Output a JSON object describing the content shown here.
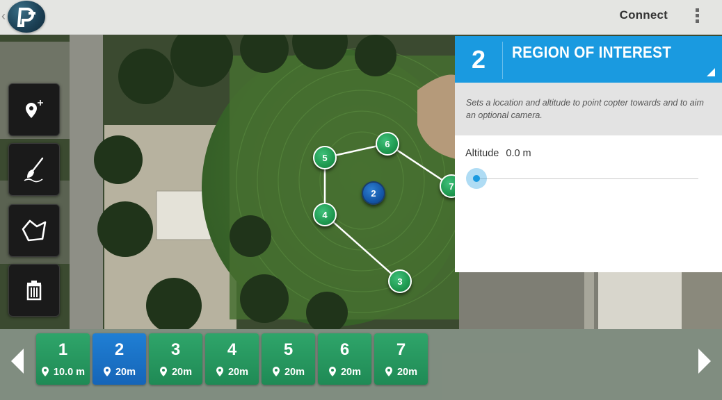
{
  "actionbar": {
    "connect_label": "Connect"
  },
  "icons": {
    "add_waypoint": "map-marker-plus-icon",
    "draw": "paintbrush-icon",
    "polygon": "polygon-icon",
    "trash": "trash-icon",
    "overflow": "more-vertical-icon",
    "logo": "droidplanner-logo"
  },
  "map": {
    "markers": [
      {
        "label": "5",
        "kind": "waypoint"
      },
      {
        "label": "6",
        "kind": "waypoint"
      },
      {
        "label": "7",
        "kind": "waypoint"
      },
      {
        "label": "2",
        "kind": "roi"
      },
      {
        "label": "4",
        "kind": "waypoint"
      },
      {
        "label": "3",
        "kind": "waypoint"
      }
    ]
  },
  "panel": {
    "number": "2",
    "title": "REGION OF INTEREST",
    "description": "Sets a location and altitude to point copter towards and to aim an optional camera.",
    "altitude_label": "Altitude",
    "altitude_value": "0.0 m",
    "altitude_slider_fraction": 0
  },
  "waypoints": [
    {
      "number": "1",
      "altitude": "10.0 m",
      "selected": false
    },
    {
      "number": "2",
      "altitude": "20m",
      "selected": true
    },
    {
      "number": "3",
      "altitude": "20m",
      "selected": false
    },
    {
      "number": "4",
      "altitude": "20m",
      "selected": false
    },
    {
      "number": "5",
      "altitude": "20m",
      "selected": false
    },
    {
      "number": "6",
      "altitude": "20m",
      "selected": false
    },
    {
      "number": "7",
      "altitude": "20m",
      "selected": false
    }
  ],
  "colors": {
    "accent_blue": "#1a9ae0",
    "waypoint_green": "#1f9950",
    "selected_blue": "#1665b8"
  }
}
